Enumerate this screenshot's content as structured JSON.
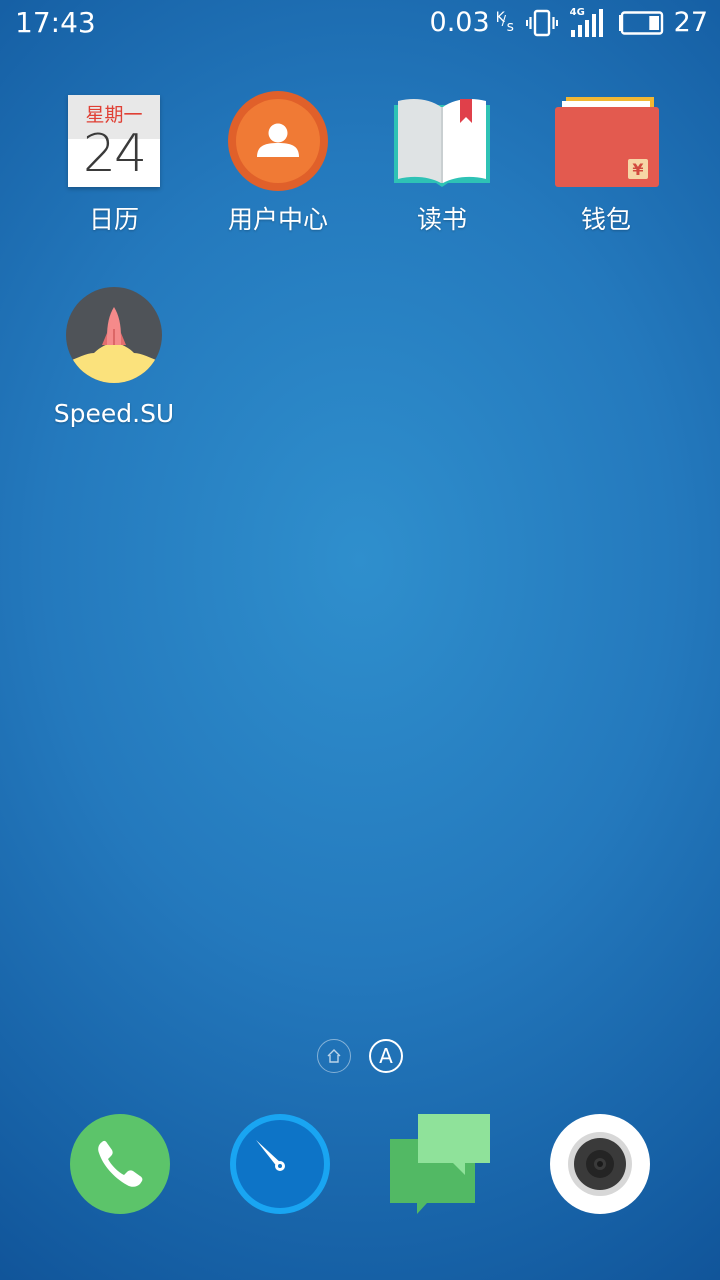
{
  "status_bar": {
    "time": "17:43",
    "net_speed": "0.03",
    "net_unit_k": "K",
    "net_unit_s": "s",
    "network_type": "4G",
    "battery_level": "27",
    "battery_fraction": 0.27
  },
  "apps": [
    {
      "label": "日历",
      "icon": "calendar-icon",
      "weekday": "星期一",
      "day": "24"
    },
    {
      "label": "用户中心",
      "icon": "user-center-icon"
    },
    {
      "label": "读书",
      "icon": "book-icon"
    },
    {
      "label": "钱包",
      "icon": "wallet-icon"
    },
    {
      "label": "Speed.SU",
      "icon": "rocket-icon"
    }
  ],
  "page_indicators": {
    "home_icon": "home-icon",
    "apps_label": "A"
  },
  "dock": [
    {
      "icon": "phone-icon",
      "color": "#5cc46a"
    },
    {
      "icon": "compass-icon",
      "color": "#1a9be8"
    },
    {
      "icon": "messages-icon",
      "color": "#8fe29a"
    },
    {
      "icon": "camera-icon",
      "color": "#ffffff"
    }
  ],
  "colors": {
    "calendar_accent": "#e04035",
    "user_center": "#ee6a2c",
    "wallet": "#e35a4f",
    "book_bookmark": "#e0404a"
  }
}
